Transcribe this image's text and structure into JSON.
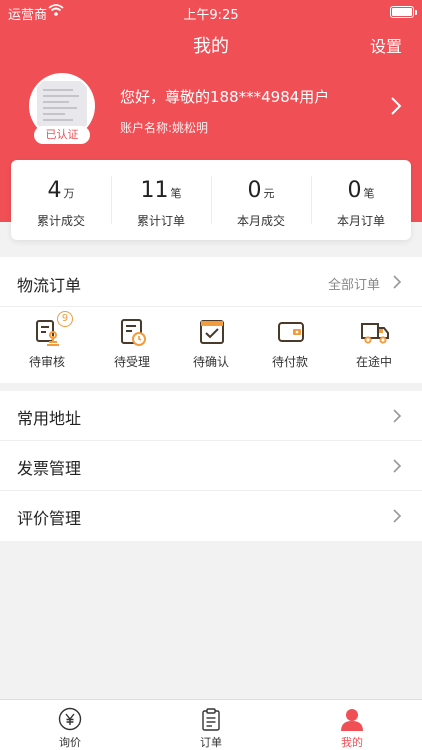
{
  "status_bar": {
    "carrier": "运营商",
    "time": "上午9:25"
  },
  "nav": {
    "title": "我的",
    "settings": "设置"
  },
  "profile": {
    "verified_badge": "已认证",
    "greeting": "您好，尊敬的188***4984用户",
    "account_name": "账户名称:姚松明"
  },
  "stats": [
    {
      "value": "4",
      "unit": "万",
      "label": "累计成交"
    },
    {
      "value": "11",
      "unit": "笔",
      "label": "累计订单"
    },
    {
      "value": "0",
      "unit": "元",
      "label": "本月成交"
    },
    {
      "value": "0",
      "unit": "笔",
      "label": "本月订单"
    }
  ],
  "orders": {
    "title": "物流订单",
    "all_link": "全部订单",
    "items": [
      {
        "label": "待审核",
        "icon": "review-icon",
        "badge": "9"
      },
      {
        "label": "待受理",
        "icon": "accept-icon"
      },
      {
        "label": "待确认",
        "icon": "confirm-icon"
      },
      {
        "label": "待付款",
        "icon": "wallet-icon"
      },
      {
        "label": "在途中",
        "icon": "truck-icon"
      }
    ]
  },
  "menu": [
    {
      "label": "常用地址"
    },
    {
      "label": "发票管理"
    },
    {
      "label": "评价管理"
    }
  ],
  "tabs": [
    {
      "label": "询价",
      "icon": "yuan-icon"
    },
    {
      "label": "订单",
      "icon": "clipboard-icon"
    },
    {
      "label": "我的",
      "icon": "user-icon",
      "active": true
    }
  ],
  "colors": {
    "primary": "#ef4f55",
    "icon_brown": "#4a3a2a",
    "icon_accent": "#f39c3d"
  }
}
